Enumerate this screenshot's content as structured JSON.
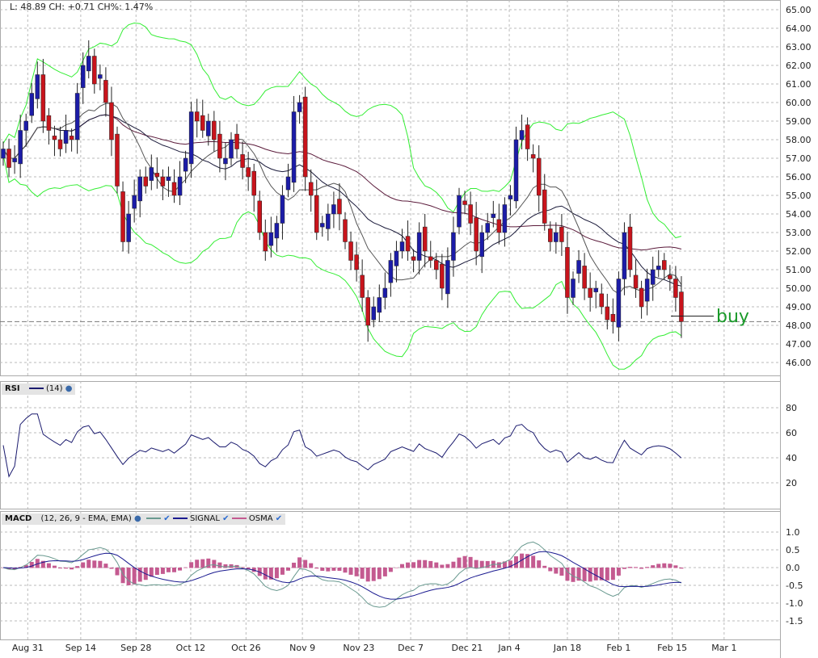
{
  "header": {
    "quote": "L: 48.89 CH: +0.71 CH%: 1.47%"
  },
  "annotation": {
    "text": "buy",
    "price": 48.5,
    "color": "#1a9a2a"
  },
  "rsi_header": {
    "name": "RSI",
    "params": "(14)"
  },
  "macd_header": {
    "name": "MACD",
    "params": "(12, 26, 9 - EMA, EMA)",
    "signal": "SIGNAL",
    "osma": "OSMA"
  },
  "colors": {
    "up": "#1c1ca8",
    "down": "#c8141c",
    "band": "#33ee33",
    "ma_fast": "#555555",
    "ma_mid": "#1a1a3a",
    "ma_slow": "#5a1a3a",
    "rsi": "#1a1a6e",
    "macd": "#6a9a90",
    "signal": "#1a1a90",
    "osma": "#c45a90"
  },
  "chart_data": [
    {
      "type": "candlestick",
      "title": "Price",
      "ylim": [
        46,
        65
      ],
      "yticks": [
        "65.00",
        "64.00",
        "63.00",
        "62.00",
        "61.00",
        "60.00",
        "59.00",
        "58.00",
        "57.00",
        "56.00",
        "55.00",
        "54.00",
        "53.00",
        "52.00",
        "51.00",
        "50.00",
        "49.00",
        "48.00",
        "47.00",
        "46.00"
      ],
      "xticks": [
        {
          "label": "Aug 31",
          "index": 4.3
        },
        {
          "label": "Sep 14",
          "index": 13.6
        },
        {
          "label": "Sep 28",
          "index": 23.3
        },
        {
          "label": "Oct 12",
          "index": 32.9
        },
        {
          "label": "Oct 26",
          "index": 42.6
        },
        {
          "label": "Nov 9",
          "index": 52.5
        },
        {
          "label": "Nov 23",
          "index": 62.4
        },
        {
          "label": "Dec 7",
          "index": 71.5
        },
        {
          "label": "Dec 21",
          "index": 81.4
        },
        {
          "label": "Jan 4",
          "index": 88.8
        },
        {
          "label": "Jan 18",
          "index": 99
        },
        {
          "label": "Feb 1",
          "index": 108
        },
        {
          "label": "Feb 15",
          "index": 117.4
        },
        {
          "label": "Mar 1",
          "index": 126.5
        }
      ],
      "reference_line": 48.2,
      "close": [
        57.5,
        56.5,
        57,
        58.5,
        59,
        60.5,
        61.5,
        59,
        58.5,
        58,
        57.5,
        58.5,
        58,
        60.5,
        62,
        62.5,
        61,
        61.5,
        60,
        58,
        55.5,
        52.5,
        54,
        55,
        56,
        55.5,
        56.5,
        56,
        55.5,
        56,
        55,
        56,
        57,
        59.5,
        59,
        58.5,
        59,
        58,
        57,
        57,
        58,
        57.5,
        56.5,
        56,
        55,
        53,
        52,
        53,
        53.5,
        55,
        56,
        59.5,
        60,
        56,
        55,
        53,
        53.5,
        54,
        54.5,
        54,
        52.5,
        51.5,
        51,
        49.5,
        48,
        49,
        49.5,
        50,
        51.5,
        52,
        52.5,
        52,
        51.5,
        53,
        52,
        51.5,
        51,
        50,
        51.5,
        53,
        55,
        54.5,
        53.5,
        52,
        53,
        53.5,
        54,
        53,
        54.5,
        55,
        58,
        58.5,
        57.5,
        57,
        55,
        53.5,
        52.5,
        53,
        52.5,
        49.5,
        50.5,
        51.5,
        50,
        49.5,
        50,
        49,
        48.3,
        48.2,
        50.5,
        53,
        51,
        50,
        49,
        50.5,
        51,
        51.2,
        51,
        50.5,
        49.5,
        48.2
      ],
      "overlays": [
        "Bollinger Bands (20,2)",
        "SMA 10",
        "SMA 20",
        "SMA 50"
      ]
    },
    {
      "type": "line",
      "title": "RSI (14)",
      "ylim": [
        0,
        100
      ],
      "yticks": [
        "80",
        "60",
        "40",
        "20"
      ]
    },
    {
      "type": "bar+line",
      "title": "MACD (12, 26, 9 - EMA, EMA)",
      "ylim": [
        -1.9,
        1.3
      ],
      "yticks": [
        "1.0",
        "0.5",
        "0.0",
        "-0.5",
        "-1.0",
        "-1.5"
      ]
    }
  ]
}
